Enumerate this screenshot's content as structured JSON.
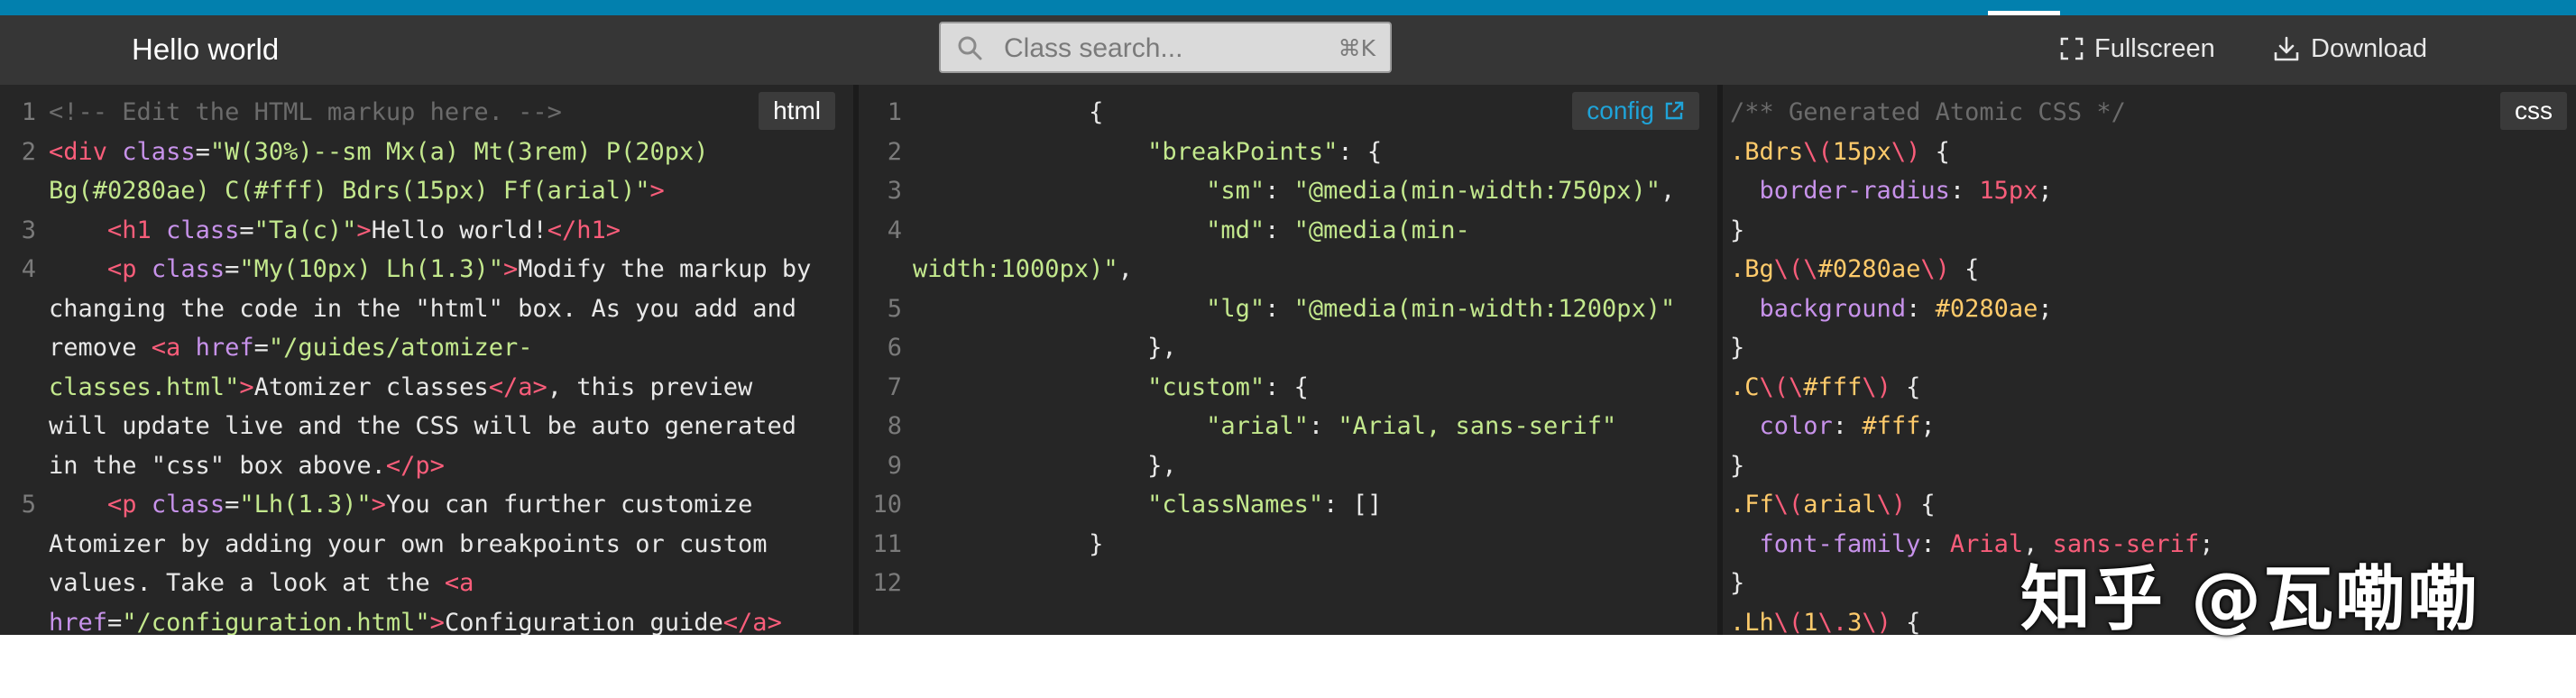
{
  "app": {
    "title": "Hello world",
    "accent_color": "#0280ae"
  },
  "search": {
    "placeholder": "Class search...",
    "shortcut": "⌘K",
    "icon": "search-icon"
  },
  "toolbar": {
    "fullscreen_label": "Fullscreen",
    "fullscreen_icon": "fullscreen-icon",
    "download_label": "Download",
    "download_icon": "download-icon"
  },
  "panes": {
    "html": {
      "badge": "html",
      "line_numbers": [
        "1",
        "2",
        "",
        "3",
        "4",
        "",
        "",
        "",
        "",
        "",
        "5",
        "",
        "",
        ""
      ],
      "lines": [
        {
          "t": [
            [
              "cm",
              "<!-- Edit the HTML markup here. -->"
            ]
          ]
        },
        {
          "t": [
            [
              "tag",
              "<div"
            ],
            [
              "pun",
              " "
            ],
            [
              "attr",
              "class"
            ],
            [
              "pun",
              "="
            ],
            [
              "str",
              "\"W(30%)--sm Mx(a) Mt(3rem) P(20px)"
            ]
          ]
        },
        {
          "t": [
            [
              "str",
              "Bg(#0280ae) C(#fff) Bdrs(15px) Ff(arial)\""
            ],
            [
              "tag",
              ">"
            ]
          ]
        },
        {
          "t": [
            [
              "pun",
              "    "
            ],
            [
              "tag",
              "<h1"
            ],
            [
              "pun",
              " "
            ],
            [
              "attr",
              "class"
            ],
            [
              "pun",
              "="
            ],
            [
              "str",
              "\"Ta(c)\""
            ],
            [
              "tag",
              ">"
            ],
            [
              "pun",
              "Hello world!"
            ],
            [
              "tag",
              "</h1>"
            ]
          ]
        },
        {
          "t": [
            [
              "pun",
              "    "
            ],
            [
              "tag",
              "<p"
            ],
            [
              "pun",
              " "
            ],
            [
              "attr",
              "class"
            ],
            [
              "pun",
              "="
            ],
            [
              "str",
              "\"My(10px) Lh(1.3)\""
            ],
            [
              "tag",
              ">"
            ],
            [
              "pun",
              "Modify the markup by"
            ]
          ]
        },
        {
          "t": [
            [
              "pun",
              "changing the code in the \"html\" box. As you add and"
            ]
          ]
        },
        {
          "t": [
            [
              "pun",
              "remove "
            ],
            [
              "tag",
              "<a"
            ],
            [
              "pun",
              " "
            ],
            [
              "attr",
              "href"
            ],
            [
              "pun",
              "="
            ],
            [
              "str",
              "\"/guides/atomizer-"
            ]
          ]
        },
        {
          "t": [
            [
              "str",
              "classes.html\""
            ],
            [
              "tag",
              ">"
            ],
            [
              "pun",
              "Atomizer classes"
            ],
            [
              "tag",
              "</a>"
            ],
            [
              "pun",
              ", this preview"
            ]
          ]
        },
        {
          "t": [
            [
              "pun",
              "will update live and the CSS will be auto generated"
            ]
          ]
        },
        {
          "t": [
            [
              "pun",
              "in the \"css\" box above."
            ],
            [
              "tag",
              "</p>"
            ]
          ]
        },
        {
          "t": [
            [
              "pun",
              "    "
            ],
            [
              "tag",
              "<p"
            ],
            [
              "pun",
              " "
            ],
            [
              "attr",
              "class"
            ],
            [
              "pun",
              "="
            ],
            [
              "str",
              "\"Lh(1.3)\""
            ],
            [
              "tag",
              ">"
            ],
            [
              "pun",
              "You can further customize"
            ]
          ]
        },
        {
          "t": [
            [
              "pun",
              "Atomizer by adding your own breakpoints or custom"
            ]
          ]
        },
        {
          "t": [
            [
              "pun",
              "values. Take a look at the "
            ],
            [
              "tag",
              "<a"
            ]
          ]
        },
        {
          "t": [
            [
              "attr",
              "href"
            ],
            [
              "pun",
              "="
            ],
            [
              "str",
              "\"/configuration.html\""
            ],
            [
              "tag",
              ">"
            ],
            [
              "pun",
              "Configuration guide"
            ],
            [
              "tag",
              "</a>"
            ]
          ]
        }
      ]
    },
    "config": {
      "badge": "config",
      "badge_icon": "external-link-icon",
      "line_numbers": [
        "1",
        "2",
        "3",
        "4",
        "",
        "5",
        "6",
        "7",
        "8",
        "9",
        "10",
        "11",
        "12"
      ],
      "lines": [
        {
          "t": [
            [
              "pun",
              "            {"
            ]
          ]
        },
        {
          "t": [
            [
              "pun",
              "                "
            ],
            [
              "str",
              "\"breakPoints\""
            ],
            [
              "pun",
              ": {"
            ]
          ]
        },
        {
          "t": [
            [
              "pun",
              "                    "
            ],
            [
              "str",
              "\"sm\""
            ],
            [
              "pun",
              ": "
            ],
            [
              "str",
              "\"@media(min-width:750px)\""
            ],
            [
              "pun",
              ","
            ]
          ]
        },
        {
          "t": [
            [
              "pun",
              "                    "
            ],
            [
              "str",
              "\"md\""
            ],
            [
              "pun",
              ": "
            ],
            [
              "str",
              "\"@media(min-"
            ]
          ]
        },
        {
          "t": [
            [
              "str",
              "width:1000px)\""
            ],
            [
              "pun",
              ","
            ]
          ]
        },
        {
          "t": [
            [
              "pun",
              "                    "
            ],
            [
              "str",
              "\"lg\""
            ],
            [
              "pun",
              ": "
            ],
            [
              "str",
              "\"@media(min-width:1200px)\""
            ]
          ]
        },
        {
          "t": [
            [
              "pun",
              "                },"
            ]
          ]
        },
        {
          "t": [
            [
              "pun",
              "                "
            ],
            [
              "str",
              "\"custom\""
            ],
            [
              "pun",
              ": {"
            ]
          ]
        },
        {
          "t": [
            [
              "pun",
              "                    "
            ],
            [
              "str",
              "\"arial\""
            ],
            [
              "pun",
              ": "
            ],
            [
              "str",
              "\"Arial, sans-serif\""
            ]
          ]
        },
        {
          "t": [
            [
              "pun",
              "                },"
            ]
          ]
        },
        {
          "t": [
            [
              "pun",
              "                "
            ],
            [
              "str",
              "\"classNames\""
            ],
            [
              "pun",
              ": []"
            ]
          ]
        },
        {
          "t": [
            [
              "pun",
              "            }"
            ]
          ]
        },
        {
          "t": [
            [
              "pun",
              ""
            ]
          ]
        }
      ]
    },
    "css": {
      "badge": "css",
      "lines": [
        {
          "t": [
            [
              "cm",
              "/** Generated Atomic CSS */"
            ]
          ]
        },
        {
          "t": [
            [
              "sel",
              ".Bdrs"
            ],
            [
              "esc",
              "\\("
            ],
            [
              "sel",
              "15px"
            ],
            [
              "esc",
              "\\)"
            ],
            [
              "pun",
              " {"
            ]
          ]
        },
        {
          "t": [
            [
              "pun",
              "  "
            ],
            [
              "prop",
              "border-radius"
            ],
            [
              "pun",
              ": "
            ],
            [
              "num",
              "15px"
            ],
            [
              "pun",
              ";"
            ]
          ]
        },
        {
          "t": [
            [
              "pun",
              "}"
            ]
          ]
        },
        {
          "t": [
            [
              "sel",
              ".Bg"
            ],
            [
              "esc",
              "\\("
            ],
            [
              "esc",
              "\\"
            ],
            [
              "sel",
              "#0280ae"
            ],
            [
              "esc",
              "\\)"
            ],
            [
              "pun",
              " {"
            ]
          ]
        },
        {
          "t": [
            [
              "pun",
              "  "
            ],
            [
              "prop",
              "background"
            ],
            [
              "pun",
              ": "
            ],
            [
              "sel",
              "#0280ae"
            ],
            [
              "pun",
              ";"
            ]
          ]
        },
        {
          "t": [
            [
              "pun",
              "}"
            ]
          ]
        },
        {
          "t": [
            [
              "sel",
              ".C"
            ],
            [
              "esc",
              "\\("
            ],
            [
              "esc",
              "\\"
            ],
            [
              "sel",
              "#fff"
            ],
            [
              "esc",
              "\\)"
            ],
            [
              "pun",
              " {"
            ]
          ]
        },
        {
          "t": [
            [
              "pun",
              "  "
            ],
            [
              "prop",
              "color"
            ],
            [
              "pun",
              ": "
            ],
            [
              "sel",
              "#fff"
            ],
            [
              "pun",
              ";"
            ]
          ]
        },
        {
          "t": [
            [
              "pun",
              "}"
            ]
          ]
        },
        {
          "t": [
            [
              "sel",
              ".Ff"
            ],
            [
              "esc",
              "\\("
            ],
            [
              "sel",
              "arial"
            ],
            [
              "esc",
              "\\)"
            ],
            [
              "pun",
              " {"
            ]
          ]
        },
        {
          "t": [
            [
              "pun",
              "  "
            ],
            [
              "prop",
              "font-family"
            ],
            [
              "pun",
              ": "
            ],
            [
              "num",
              "Arial"
            ],
            [
              "pun",
              ", "
            ],
            [
              "num",
              "sans-serif"
            ],
            [
              "pun",
              ";"
            ]
          ]
        },
        {
          "t": [
            [
              "pun",
              "}"
            ]
          ]
        },
        {
          "t": [
            [
              "sel",
              ".Lh"
            ],
            [
              "esc",
              "\\("
            ],
            [
              "sel",
              "1"
            ],
            [
              "esc",
              "\\."
            ],
            [
              "sel",
              "3"
            ],
            [
              "esc",
              "\\)"
            ],
            [
              "pun",
              " {"
            ]
          ]
        }
      ]
    }
  },
  "watermark": "知乎 @瓦嘞嘞"
}
